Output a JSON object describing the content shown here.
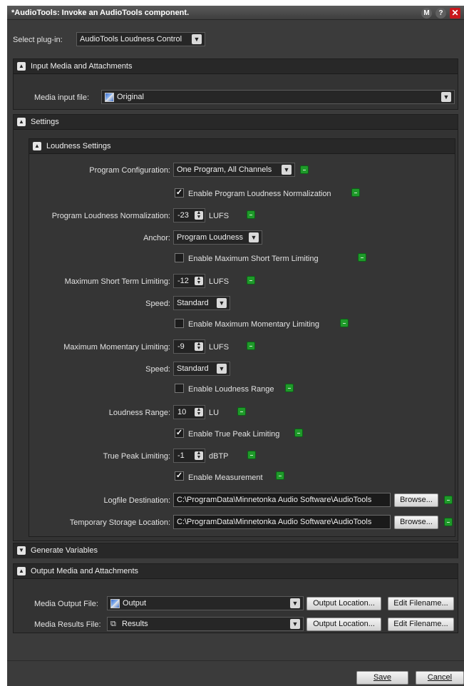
{
  "window": {
    "title": "*AudioTools: Invoke an AudioTools component.",
    "btn_m": "M",
    "btn_help": "?",
    "btn_close": "✕"
  },
  "plugin": {
    "label": "Select plug-in:",
    "value": "AudioTools Loudness Control"
  },
  "input_media": {
    "title": "Input Media and Attachments",
    "media_input_label": "Media input file:",
    "media_input_value": "Original"
  },
  "settings": {
    "title": "Settings",
    "loudness": {
      "title": "Loudness Settings",
      "program_configuration_label": "Program Configuration:",
      "program_configuration_value": "One Program, All Channels",
      "enable_normalization_label": "Enable Program Loudness Normalization",
      "enable_normalization_checked": true,
      "normalization_label": "Program Loudness Normalization:",
      "normalization_value": "-23",
      "normalization_unit": "LUFS",
      "anchor_label": "Anchor:",
      "anchor_value": "Program Loudness",
      "enable_short_term_label": "Enable Maximum Short Term Limiting",
      "enable_short_term_checked": false,
      "short_term_label": "Maximum Short Term Limiting:",
      "short_term_value": "-12",
      "short_term_unit": "LUFS",
      "speed_label": "Speed:",
      "speed_value": "Standard",
      "enable_momentary_label": "Enable Maximum Momentary Limiting",
      "enable_momentary_checked": false,
      "momentary_label": "Maximum Momentary Limiting:",
      "momentary_value": "-9",
      "momentary_unit": "LUFS",
      "speed2_label": "Speed:",
      "speed2_value": "Standard",
      "enable_range_label": "Enable Loudness Range",
      "enable_range_checked": false,
      "range_label": "Loudness Range:",
      "range_value": "10",
      "range_unit": "LU",
      "enable_true_peak_label": "Enable True Peak Limiting",
      "enable_true_peak_checked": true,
      "true_peak_label": "True Peak Limiting:",
      "true_peak_value": "-1",
      "true_peak_unit": "dBTP",
      "enable_measurement_label": "Enable Measurement",
      "enable_measurement_checked": true,
      "logfile_label": "Logfile Destination:",
      "logfile_value": "C:\\ProgramData\\Minnetonka Audio Software\\AudioTools",
      "temp_label": "Temporary Storage Location:",
      "temp_value": "C:\\ProgramData\\Minnetonka Audio Software\\AudioTools",
      "browse_label": "Browse..."
    }
  },
  "generate_variables": {
    "title": "Generate Variables"
  },
  "output_media": {
    "title": "Output Media and Attachments",
    "output_file_label": "Media Output File:",
    "output_file_value": "Output",
    "results_file_label": "Media Results File:",
    "results_file_value": "Results",
    "output_location_label": "Output Location...",
    "edit_filename_label": "Edit Filename..."
  },
  "footer": {
    "save_label": "Save",
    "cancel_label": "Cancel"
  }
}
